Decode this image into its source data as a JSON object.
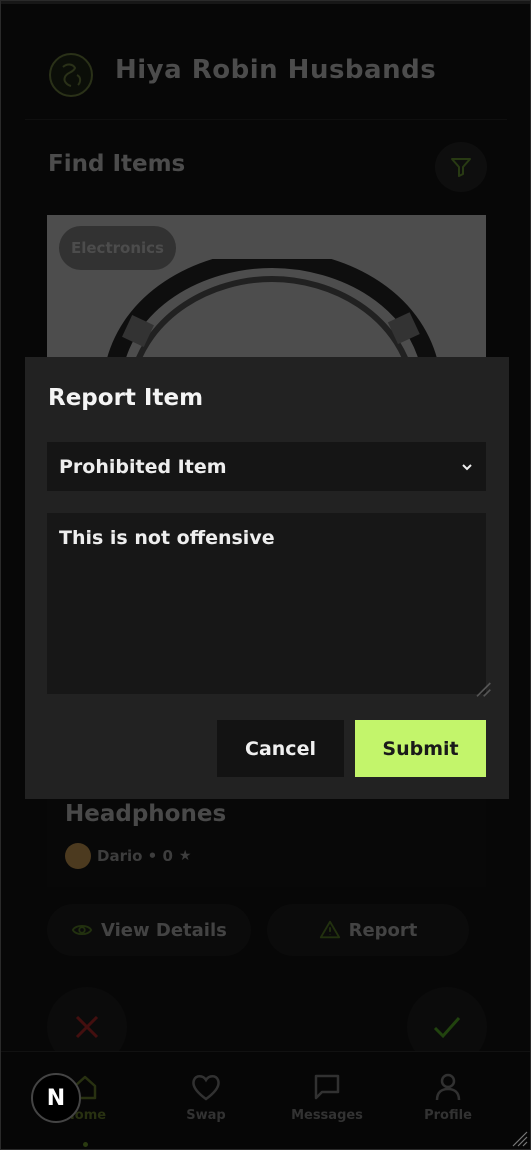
{
  "app": {
    "user_name": "Hiya Robin Husbands"
  },
  "main": {
    "section_title": "Find Items"
  },
  "item": {
    "category": "Electronics",
    "name": "Headphones",
    "owner": "Dario",
    "rating": "0",
    "owner_line": "Dario • 0"
  },
  "actions": {
    "view_details": "View Details",
    "report": "Report"
  },
  "nav": [
    {
      "label": "Home",
      "icon": "home-icon",
      "active": true
    },
    {
      "label": "Swap",
      "icon": "heart-icon",
      "active": false
    },
    {
      "label": "Messages",
      "icon": "message-icon",
      "active": false
    },
    {
      "label": "Profile",
      "icon": "user-icon",
      "active": false
    }
  ],
  "dev_badge": "N",
  "modal": {
    "title": "Report Item",
    "reason_selected": "Prohibited Item",
    "details_value": "This is not offensive",
    "cancel_label": "Cancel",
    "submit_label": "Submit"
  },
  "colors": {
    "accent": "#c3f56b",
    "background": "#0d0d0d",
    "modal_bg": "#222222",
    "reject": "#8a1f1f",
    "accept": "#4e8f1f"
  }
}
